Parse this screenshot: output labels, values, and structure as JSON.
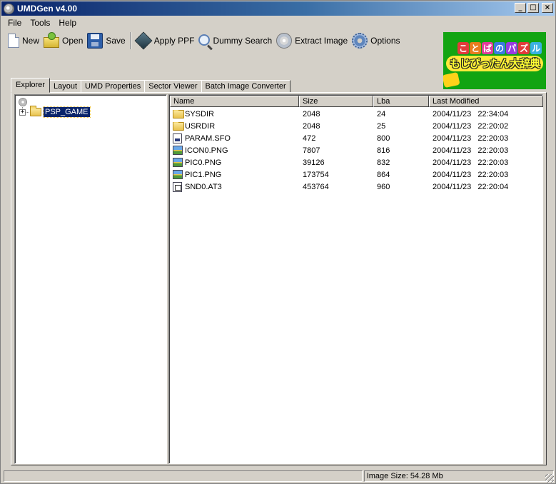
{
  "window": {
    "title": "UMDGen v4.00"
  },
  "menu": [
    "File",
    "Tools",
    "Help"
  ],
  "toolbar": {
    "new": "New",
    "open": "Open",
    "save": "Save",
    "apply_ppf": "Apply PPF",
    "dummy_search": "Dummy Search",
    "extract_image": "Extract Image",
    "options": "Options"
  },
  "banner": {
    "line1": [
      "こ",
      "と",
      "ば",
      "の",
      "パ",
      "ズ",
      "ル"
    ],
    "line2": "もじぴったん大辞典"
  },
  "tabs": [
    "Explorer",
    "Layout",
    "UMD Properties",
    "Sector Viewer",
    "Batch Image Converter"
  ],
  "tree": {
    "expander": "+",
    "node": "PSP_GAME"
  },
  "list": {
    "columns": [
      "Name",
      "Size",
      "Lba",
      "Last Modified"
    ],
    "rows": [
      {
        "icon": "folder-icon",
        "name": "SYSDIR",
        "size": "2048",
        "lba": "24",
        "modified": "2004/11/23   22:34:04"
      },
      {
        "icon": "folder-icon",
        "name": "USRDIR",
        "size": "2048",
        "lba": "25",
        "modified": "2004/11/23   22:20:02"
      },
      {
        "icon": "sfo-file-icon",
        "name": "PARAM.SFO",
        "size": "472",
        "lba": "800",
        "modified": "2004/11/23   22:20:03"
      },
      {
        "icon": "png-file-icon",
        "name": "ICON0.PNG",
        "size": "7807",
        "lba": "816",
        "modified": "2004/11/23   22:20:03"
      },
      {
        "icon": "png-file-icon",
        "name": "PIC0.PNG",
        "size": "39126",
        "lba": "832",
        "modified": "2004/11/23   22:20:03"
      },
      {
        "icon": "png-file-icon",
        "name": "PIC1.PNG",
        "size": "173754",
        "lba": "864",
        "modified": "2004/11/23   22:20:03"
      },
      {
        "icon": "at3-file-icon",
        "name": "SND0.AT3",
        "size": "453764",
        "lba": "960",
        "modified": "2004/11/23   22:20:04"
      }
    ]
  },
  "status": {
    "left": "",
    "image_size": "Image Size: 54.28 Mb"
  }
}
